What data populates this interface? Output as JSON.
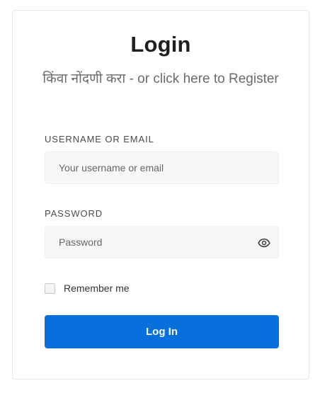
{
  "login_form": {
    "title": "Login",
    "register_link_text": "किंवा नोंदणी करा - or click here to Register",
    "username": {
      "label": "USERNAME OR EMAIL",
      "placeholder": "Your username or email",
      "value": ""
    },
    "password": {
      "label": "PASSWORD",
      "placeholder": "Password",
      "value": "",
      "toggle_icon": "eye-icon"
    },
    "remember_me": {
      "label": "Remember me",
      "checked": false
    },
    "submit_label": "Log In",
    "colors": {
      "primary": "#0870dc",
      "field_background": "#f7f7f7",
      "heading": "#1f1f1f",
      "muted_text": "#6b6b6b"
    }
  }
}
